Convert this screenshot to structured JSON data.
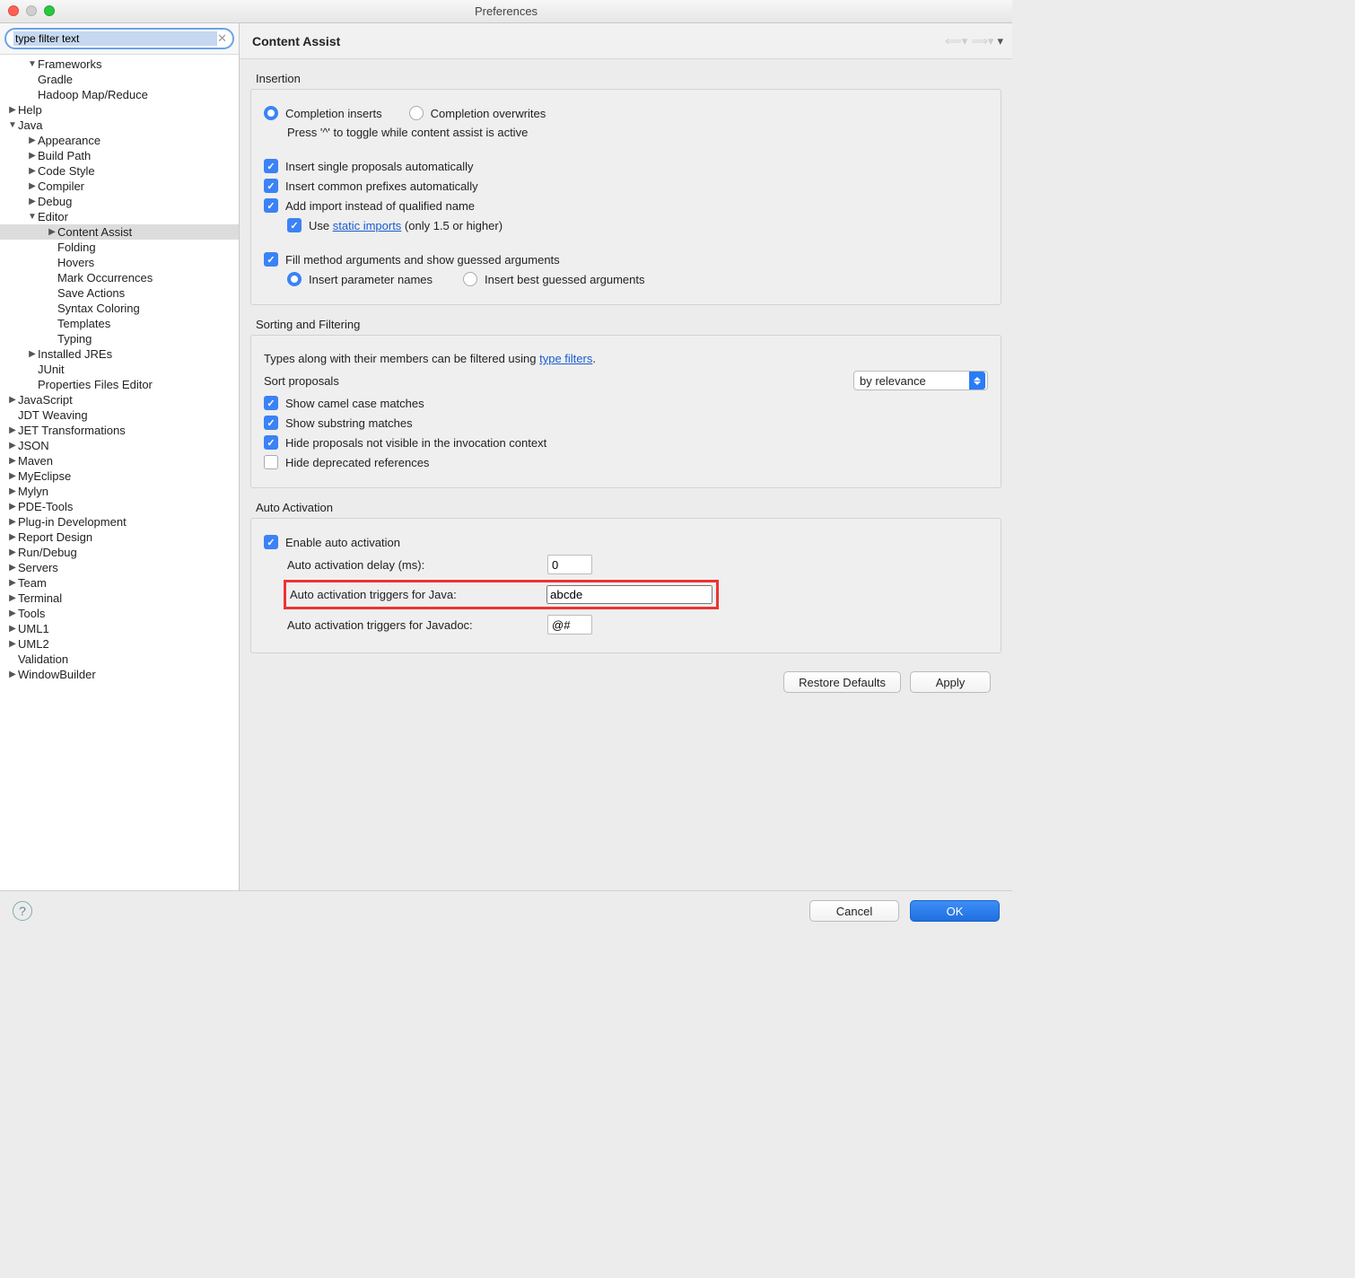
{
  "window": {
    "title": "Preferences"
  },
  "filter": {
    "placeholder": "type filter text"
  },
  "tree": [
    {
      "label": "Frameworks",
      "depth": 1,
      "arrow": "down"
    },
    {
      "label": "Gradle",
      "depth": 1,
      "arrow": ""
    },
    {
      "label": "Hadoop Map/Reduce",
      "depth": 1,
      "arrow": ""
    },
    {
      "label": "Help",
      "depth": 0,
      "arrow": "right"
    },
    {
      "label": "Java",
      "depth": 0,
      "arrow": "down"
    },
    {
      "label": "Appearance",
      "depth": 1,
      "arrow": "right"
    },
    {
      "label": "Build Path",
      "depth": 1,
      "arrow": "right"
    },
    {
      "label": "Code Style",
      "depth": 1,
      "arrow": "right"
    },
    {
      "label": "Compiler",
      "depth": 1,
      "arrow": "right"
    },
    {
      "label": "Debug",
      "depth": 1,
      "arrow": "right"
    },
    {
      "label": "Editor",
      "depth": 1,
      "arrow": "down"
    },
    {
      "label": "Content Assist",
      "depth": 2,
      "arrow": "right",
      "sel": true
    },
    {
      "label": "Folding",
      "depth": 2,
      "arrow": ""
    },
    {
      "label": "Hovers",
      "depth": 2,
      "arrow": ""
    },
    {
      "label": "Mark Occurrences",
      "depth": 2,
      "arrow": ""
    },
    {
      "label": "Save Actions",
      "depth": 2,
      "arrow": ""
    },
    {
      "label": "Syntax Coloring",
      "depth": 2,
      "arrow": ""
    },
    {
      "label": "Templates",
      "depth": 2,
      "arrow": ""
    },
    {
      "label": "Typing",
      "depth": 2,
      "arrow": ""
    },
    {
      "label": "Installed JREs",
      "depth": 1,
      "arrow": "right"
    },
    {
      "label": "JUnit",
      "depth": 1,
      "arrow": ""
    },
    {
      "label": "Properties Files Editor",
      "depth": 1,
      "arrow": ""
    },
    {
      "label": "JavaScript",
      "depth": 0,
      "arrow": "right"
    },
    {
      "label": "JDT Weaving",
      "depth": 0,
      "arrow": ""
    },
    {
      "label": "JET Transformations",
      "depth": 0,
      "arrow": "right"
    },
    {
      "label": "JSON",
      "depth": 0,
      "arrow": "right"
    },
    {
      "label": "Maven",
      "depth": 0,
      "arrow": "right"
    },
    {
      "label": "MyEclipse",
      "depth": 0,
      "arrow": "right"
    },
    {
      "label": "Mylyn",
      "depth": 0,
      "arrow": "right"
    },
    {
      "label": "PDE-Tools",
      "depth": 0,
      "arrow": "right"
    },
    {
      "label": "Plug-in Development",
      "depth": 0,
      "arrow": "right"
    },
    {
      "label": "Report Design",
      "depth": 0,
      "arrow": "right"
    },
    {
      "label": "Run/Debug",
      "depth": 0,
      "arrow": "right"
    },
    {
      "label": "Servers",
      "depth": 0,
      "arrow": "right"
    },
    {
      "label": "Team",
      "depth": 0,
      "arrow": "right"
    },
    {
      "label": "Terminal",
      "depth": 0,
      "arrow": "right"
    },
    {
      "label": "Tools",
      "depth": 0,
      "arrow": "right"
    },
    {
      "label": "UML1",
      "depth": 0,
      "arrow": "right"
    },
    {
      "label": "UML2",
      "depth": 0,
      "arrow": "right"
    },
    {
      "label": "Validation",
      "depth": 0,
      "arrow": ""
    },
    {
      "label": "WindowBuilder",
      "depth": 0,
      "arrow": "right"
    }
  ],
  "page": {
    "title": "Content Assist",
    "sections": {
      "insertion": {
        "title": "Insertion",
        "radio_inserts": "Completion inserts",
        "radio_overwrites": "Completion overwrites",
        "toggle_hint": "Press '^' to toggle while content assist is active",
        "chk_single": "Insert single proposals automatically",
        "chk_prefix": "Insert common prefixes automatically",
        "chk_import": "Add import instead of qualified name",
        "chk_static_pre": "Use ",
        "chk_static_link": "static imports",
        "chk_static_post": " (only 1.5 or higher)",
        "chk_fill": "Fill method arguments and show guessed arguments",
        "radio_paramnames": "Insert parameter names",
        "radio_bestguess": "Insert best guessed arguments"
      },
      "sorting": {
        "title": "Sorting and Filtering",
        "filter_text_pre": "Types along with their members can be filtered using ",
        "filter_link": "type filters",
        "filter_post": ".",
        "sort_label": "Sort proposals",
        "sort_value": "by relevance",
        "chk_camel": "Show camel case matches",
        "chk_substring": "Show substring matches",
        "chk_hidenotvis": "Hide proposals not visible in the invocation context",
        "chk_hidedepr": "Hide deprecated references"
      },
      "auto": {
        "title": "Auto Activation",
        "chk_enable": "Enable auto activation",
        "delay_label": "Auto activation delay (ms):",
        "delay_value": "0",
        "java_label": "Auto activation triggers for Java:",
        "java_value": "abcde",
        "jdoc_label": "Auto activation triggers for Javadoc:",
        "jdoc_value": "@#"
      }
    },
    "buttons": {
      "restore": "Restore Defaults",
      "apply": "Apply",
      "cancel": "Cancel",
      "ok": "OK"
    }
  }
}
